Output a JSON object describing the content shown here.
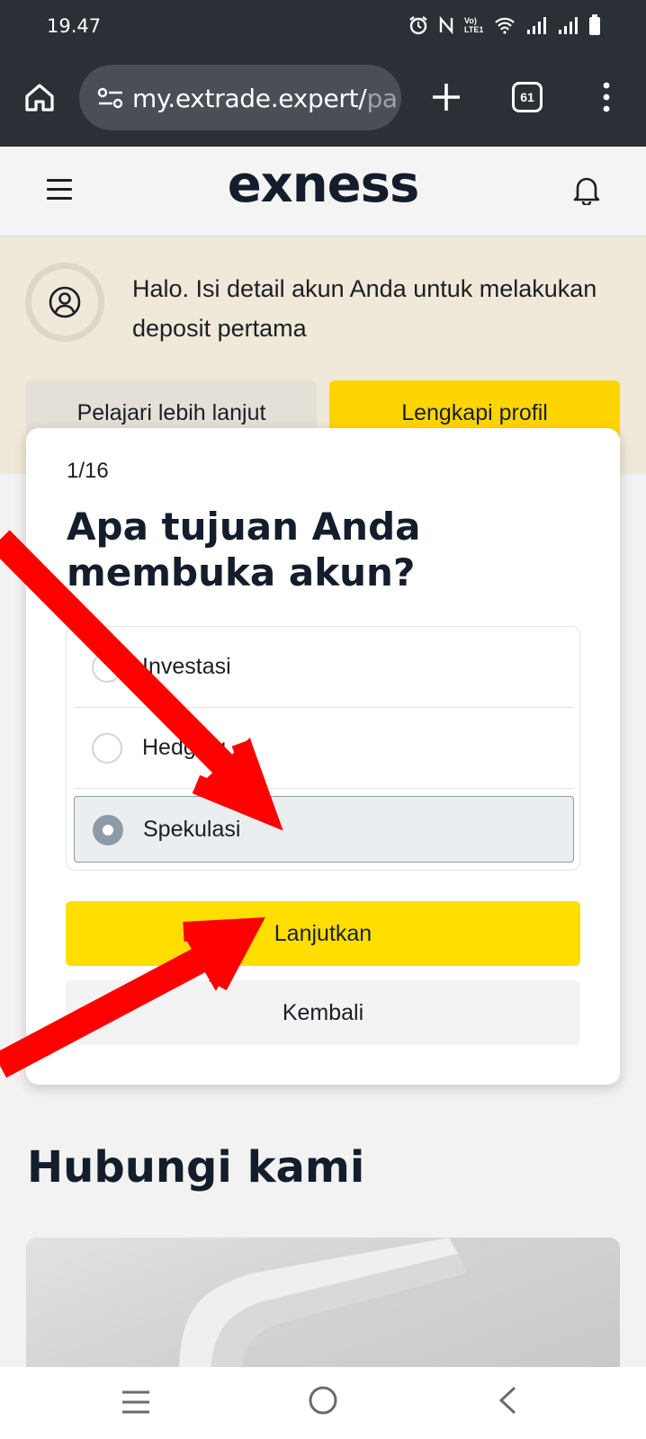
{
  "status_bar": {
    "time": "19.47",
    "signal_label": "Vo) LTE1"
  },
  "browser": {
    "url_main": "my.extrade.expert/",
    "url_rest": "pa",
    "tab_count": "61"
  },
  "app": {
    "logo": "exness"
  },
  "banner": {
    "message": "Halo. Isi detail akun Anda untuk melakukan deposit pertama",
    "learn_more_label": "Pelajari lebih lanjut",
    "complete_profile_label": "Lengkapi profil"
  },
  "questionnaire": {
    "step": "1/16",
    "question": "Apa tujuan Anda membuka akun?",
    "options": [
      {
        "label": "Investasi",
        "selected": false
      },
      {
        "label": "Hedging",
        "selected": false
      },
      {
        "label": "Spekulasi",
        "selected": true
      }
    ],
    "continue_label": "Lanjutkan",
    "back_label": "Kembali"
  },
  "contact": {
    "title": "Hubungi kami"
  },
  "colors": {
    "accent_yellow": "#ffde00",
    "arrow_red": "#ff0000",
    "chrome_dark": "#2b2f36"
  }
}
